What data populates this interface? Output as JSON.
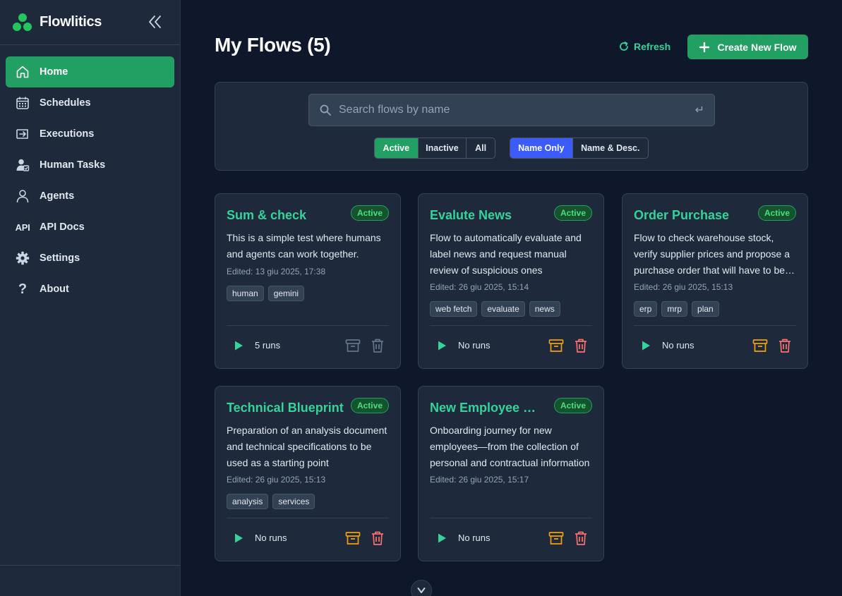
{
  "app": {
    "name": "Flowlitics"
  },
  "sidebar": {
    "items": [
      {
        "label": "Home",
        "icon": "home-icon",
        "active": true
      },
      {
        "label": "Schedules",
        "icon": "calendar-icon"
      },
      {
        "label": "Executions",
        "icon": "executions-icon"
      },
      {
        "label": "Human Tasks",
        "icon": "user-check-icon"
      },
      {
        "label": "Agents",
        "icon": "user-icon"
      },
      {
        "label": "API Docs",
        "icon": "api-icon",
        "icon_text": "API"
      },
      {
        "label": "Settings",
        "icon": "gear-icon"
      },
      {
        "label": "About",
        "icon": "question-icon",
        "icon_text": "?"
      }
    ]
  },
  "header": {
    "title": "My Flows (5)",
    "refresh_label": "Refresh",
    "create_label": "Create New Flow"
  },
  "filters": {
    "search_placeholder": "Search flows by name",
    "search_value": "",
    "status": {
      "active": "Active",
      "inactive": "Inactive",
      "all": "All",
      "selected": "Active"
    },
    "scope": {
      "name_only": "Name Only",
      "name_desc": "Name & Desc.",
      "selected": "Name Only"
    }
  },
  "flows": [
    {
      "title": "Sum & check",
      "status": "Active",
      "description": "This is a simple test where humans and agents can work together.",
      "edited": "Edited: 13 giu 2025, 17:38",
      "tags": [
        "human",
        "gemini"
      ],
      "runs": "5 runs"
    },
    {
      "title": "Evalute News",
      "status": "Active",
      "description": "Flow to automatically evaluate and label news and request manual review of suspicious ones",
      "edited": "Edited: 26 giu 2025, 15:14",
      "tags": [
        "web fetch",
        "evaluate",
        "news"
      ],
      "runs": "No runs"
    },
    {
      "title": "Order Purchase",
      "status": "Active",
      "description": "Flow to check warehouse stock, verify supplier prices and propose a purchase order that will have to be approved",
      "edited": "Edited: 26 giu 2025, 15:13",
      "tags": [
        "erp",
        "mrp",
        "plan"
      ],
      "runs": "No runs"
    },
    {
      "title": "Technical Blueprint",
      "status": "Active",
      "description": "Preparation of an analysis document and technical specifications to be used as a starting point",
      "edited": "Edited: 26 giu 2025, 15:13",
      "tags": [
        "analysis",
        "services"
      ],
      "runs": "No runs"
    },
    {
      "title": "New Employee Onboarding",
      "status": "Active",
      "description": "Onboarding journey for new employees—from the collection of personal and contractual information",
      "edited": "Edited: 26 giu 2025, 15:17",
      "tags": [],
      "runs": "No runs"
    }
  ],
  "colors": {
    "accent": "#22a063",
    "link": "#34d399",
    "blue": "#3b5bfd",
    "warning": "#f59e0b",
    "danger": "#f87171"
  }
}
